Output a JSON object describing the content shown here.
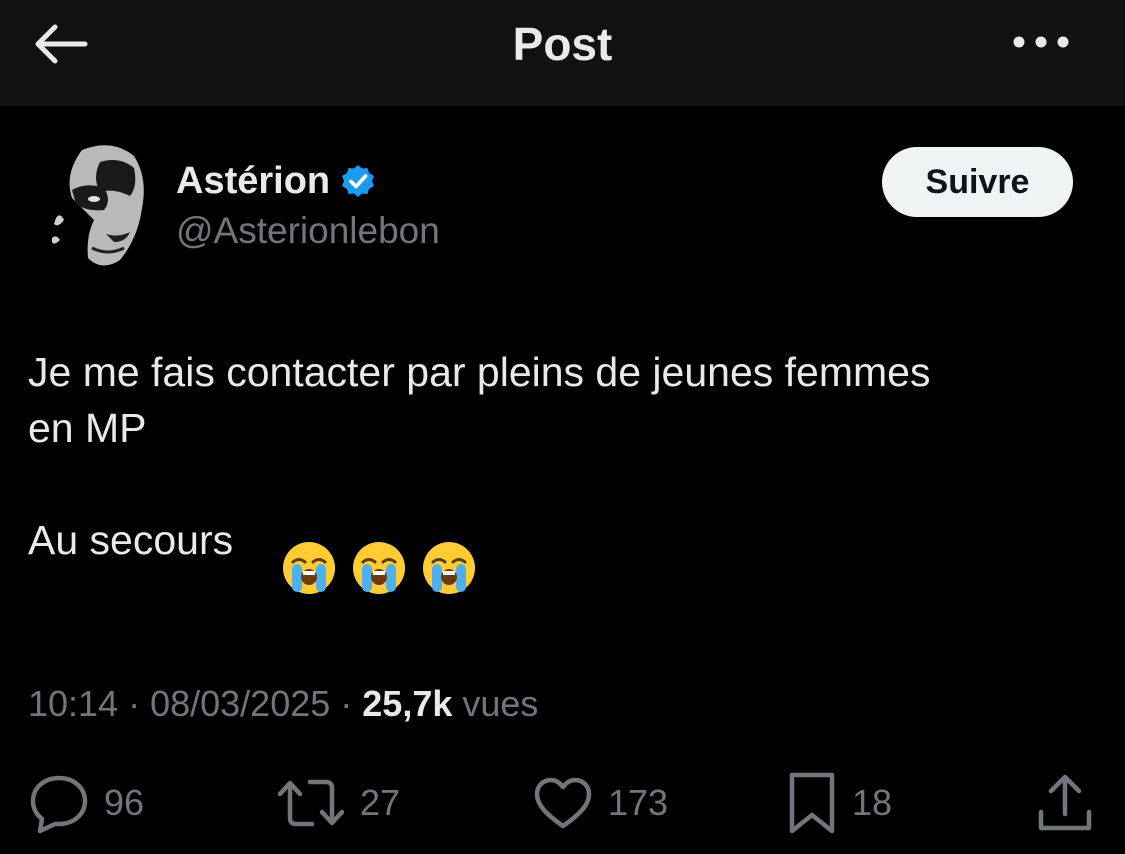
{
  "header": {
    "title": "Post",
    "back_icon": "arrow-left-icon",
    "more_icon": "more-dots-icon"
  },
  "author": {
    "display_name": "Astérion",
    "handle": "@Asterionlebon",
    "verified": true,
    "verified_color": "#1d9bf0"
  },
  "follow_button": {
    "label": "Suivre"
  },
  "tweet": {
    "text": "Je me fais contacter par pleins de jeunes femmes\nen MP\n\nAu secours",
    "emojis": [
      "loudly-crying-face",
      "loudly-crying-face",
      "loudly-crying-face"
    ]
  },
  "meta": {
    "time": "10:14",
    "separator": " · ",
    "date": "08/03/2025",
    "views_count": "25,7k",
    "views_label": "vues"
  },
  "actions": {
    "replies": {
      "icon": "reply-icon",
      "count": "96"
    },
    "reposts": {
      "icon": "repost-icon",
      "count": "27"
    },
    "likes": {
      "icon": "heart-icon",
      "count": "173"
    },
    "bookmarks": {
      "icon": "bookmark-icon",
      "count": "18"
    },
    "share": {
      "icon": "share-icon"
    }
  },
  "colors": {
    "background": "#000000",
    "header_background": "#111111",
    "primary_text": "#e7e9ea",
    "secondary_text": "#71767b",
    "follow_bg": "#eff3f4"
  }
}
